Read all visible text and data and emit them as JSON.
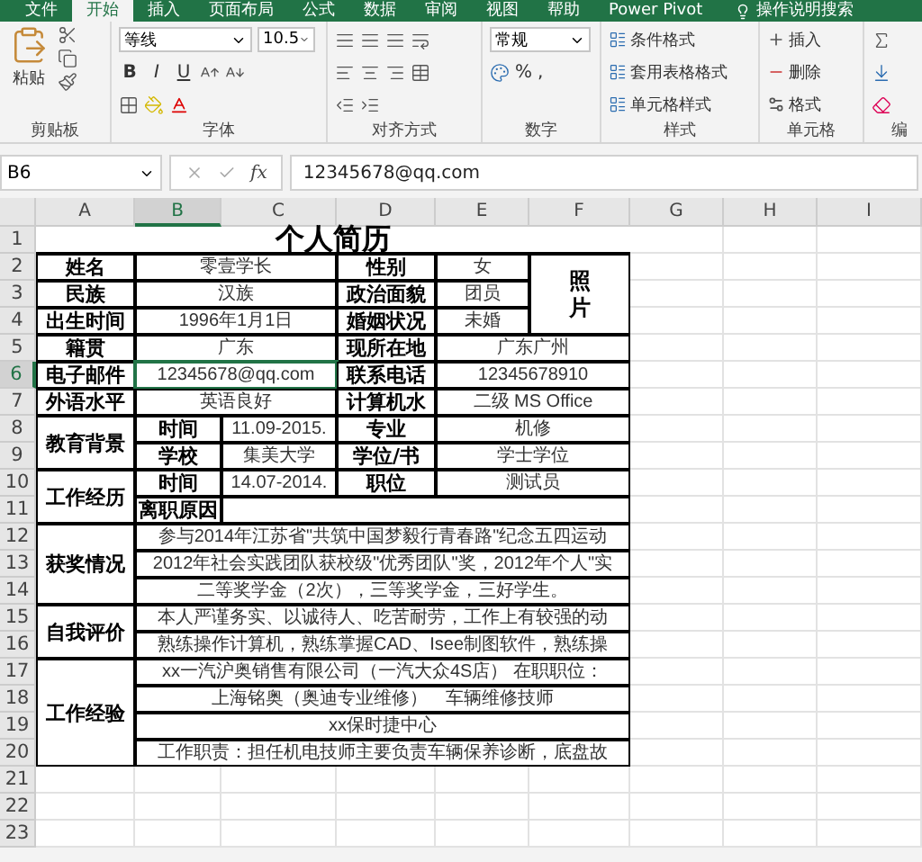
{
  "ribbon_tabs": [
    {
      "label": "文件",
      "selected": false
    },
    {
      "label": "开始",
      "selected": true
    },
    {
      "label": "插入",
      "selected": false
    },
    {
      "label": "页面布局",
      "selected": false
    },
    {
      "label": "公式",
      "selected": false
    },
    {
      "label": "数据",
      "selected": false
    },
    {
      "label": "审阅",
      "selected": false
    },
    {
      "label": "视图",
      "selected": false
    },
    {
      "label": "帮助",
      "selected": false
    },
    {
      "label": "Power Pivot",
      "selected": false
    }
  ],
  "tell_me": "操作说明搜索",
  "clipboard": {
    "paste": "粘贴",
    "title": "剪贴板"
  },
  "font": {
    "name": "等线",
    "size": "10.5",
    "bold": "B",
    "italic": "I",
    "underline": "U",
    "title": "字体"
  },
  "alignment": {
    "title": "对齐方式"
  },
  "number": {
    "format": "常规",
    "percent": "%",
    "comma": ",",
    "title": "数字"
  },
  "styles": {
    "items": [
      "条件格式",
      "套用表格格式",
      "单元格样式"
    ],
    "title": "样式"
  },
  "cells_group": {
    "items": [
      "插入",
      "删除",
      "格式"
    ],
    "title": "单元格"
  },
  "editing": {
    "title": "编"
  },
  "formula_bar": {
    "name_box": "B6",
    "fx": "fx",
    "value": "12345678@qq.com"
  },
  "sheet": {
    "columns": [
      {
        "label": "A",
        "selected": false
      },
      {
        "label": "B",
        "selected": true
      },
      {
        "label": "C",
        "selected": false
      },
      {
        "label": "D",
        "selected": false
      },
      {
        "label": "E",
        "selected": false
      },
      {
        "label": "F",
        "selected": false
      },
      {
        "label": "G",
        "selected": false
      },
      {
        "label": "H",
        "selected": false
      },
      {
        "label": "I",
        "selected": false
      }
    ],
    "rows": [
      {
        "label": "1",
        "selected": false
      },
      {
        "label": "2",
        "selected": false
      },
      {
        "label": "3",
        "selected": false
      },
      {
        "label": "4",
        "selected": false
      },
      {
        "label": "5",
        "selected": false
      },
      {
        "label": "6",
        "selected": true
      },
      {
        "label": "7",
        "selected": false
      },
      {
        "label": "8",
        "selected": false
      },
      {
        "label": "9",
        "selected": false
      },
      {
        "label": "10",
        "selected": false
      },
      {
        "label": "11",
        "selected": false
      },
      {
        "label": "12",
        "selected": false
      },
      {
        "label": "13",
        "selected": false
      },
      {
        "label": "14",
        "selected": false
      },
      {
        "label": "15",
        "selected": false
      },
      {
        "label": "16",
        "selected": false
      },
      {
        "label": "17",
        "selected": false
      },
      {
        "label": "18",
        "selected": false
      },
      {
        "label": "19",
        "selected": false
      },
      {
        "label": "20",
        "selected": false
      },
      {
        "label": "21",
        "selected": false
      },
      {
        "label": "22",
        "selected": false
      },
      {
        "label": "23",
        "selected": false
      }
    ],
    "cells": [
      {
        "kind": "title",
        "text": "个人简历",
        "selected": false
      },
      {
        "kind": "label",
        "text": "姓名",
        "selected": false
      },
      {
        "kind": "value",
        "text": "零壹学长",
        "selected": false
      },
      {
        "kind": "label",
        "text": "性别",
        "selected": false
      },
      {
        "kind": "value",
        "text": "女",
        "selected": false
      },
      {
        "kind": "label",
        "text": "民族",
        "selected": false
      },
      {
        "kind": "value",
        "text": "汉族",
        "selected": false
      },
      {
        "kind": "label",
        "text": "政治面貌",
        "selected": false
      },
      {
        "kind": "value",
        "text": "团员",
        "selected": false
      },
      {
        "kind": "label",
        "text": "出生时间",
        "selected": false
      },
      {
        "kind": "value",
        "text": "1996年1月1日",
        "selected": false
      },
      {
        "kind": "label",
        "text": "婚姻状况",
        "selected": false
      },
      {
        "kind": "value",
        "text": "未婚",
        "selected": false
      },
      {
        "kind": "photo",
        "text": "照片",
        "selected": false
      },
      {
        "kind": "label",
        "text": "籍贯",
        "selected": false
      },
      {
        "kind": "value",
        "text": "广东",
        "selected": false
      },
      {
        "kind": "label",
        "text": "现所在地",
        "selected": false
      },
      {
        "kind": "value",
        "text": "广东广州",
        "selected": false
      },
      {
        "kind": "label",
        "text": "电子邮件",
        "selected": false
      },
      {
        "kind": "value",
        "text": "12345678@qq.com",
        "selected": true
      },
      {
        "kind": "label",
        "text": "联系电话",
        "selected": false
      },
      {
        "kind": "value",
        "text": "12345678910",
        "selected": false
      },
      {
        "kind": "label",
        "text": "外语水平",
        "selected": false
      },
      {
        "kind": "value",
        "text": "英语良好",
        "selected": false
      },
      {
        "kind": "label",
        "text": "计算机水",
        "selected": false
      },
      {
        "kind": "value",
        "text": "二级 MS Office",
        "selected": false
      },
      {
        "kind": "label",
        "text": "教育背景",
        "selected": false
      },
      {
        "kind": "label",
        "text": "时间",
        "selected": false
      },
      {
        "kind": "value",
        "text": "11.09-2015.",
        "selected": false
      },
      {
        "kind": "label",
        "text": "专业",
        "selected": false
      },
      {
        "kind": "value",
        "text": "机修",
        "selected": false
      },
      {
        "kind": "label",
        "text": "学校",
        "selected": false
      },
      {
        "kind": "value",
        "text": "集美大学",
        "selected": false
      },
      {
        "kind": "label",
        "text": "学位/书",
        "selected": false
      },
      {
        "kind": "value",
        "text": "学士学位",
        "selected": false
      },
      {
        "kind": "label",
        "text": "工作经历",
        "selected": false
      },
      {
        "kind": "label",
        "text": "时间",
        "selected": false
      },
      {
        "kind": "value",
        "text": "14.07-2014.",
        "selected": false
      },
      {
        "kind": "label",
        "text": "职位",
        "selected": false
      },
      {
        "kind": "value",
        "text": "测试员",
        "selected": false
      },
      {
        "kind": "label",
        "text": "离职原因",
        "selected": false
      },
      {
        "kind": "value",
        "selected": false
      },
      {
        "kind": "label",
        "text": "获奖情况",
        "selected": false
      },
      {
        "kind": "value",
        "text": "参与2014年江苏省\"共筑中国梦毅行青春路\"纪念五四运动",
        "selected": false
      },
      {
        "kind": "value",
        "text": "2012年社会实践团队获校级\"优秀团队\"奖，2012年个人\"实",
        "selected": false
      },
      {
        "kind": "value",
        "text": "二等奖学金（2次），三等奖学金，三好学生。",
        "selected": false
      },
      {
        "kind": "label",
        "text": "自我评价",
        "selected": false
      },
      {
        "kind": "value",
        "text": "本人严谨务实、以诚待人、吃苦耐劳，工作上有较强的动",
        "selected": false
      },
      {
        "kind": "value",
        "text": "熟练操作计算机，熟练掌握CAD、Isee制图软件，熟练操",
        "selected": false
      },
      {
        "kind": "label",
        "text": "工作经验",
        "selected": false
      },
      {
        "kind": "value",
        "text": "xx一汽沪奥销售有限公司（一汽大众4S店） 在职职位：",
        "selected": false
      },
      {
        "kind": "value",
        "text": "上海铭奥（奥迪专业维修）　车辆维修技师",
        "selected": false
      },
      {
        "kind": "value",
        "text": "xx保时捷中心",
        "selected": false
      },
      {
        "kind": "value",
        "text": "工作职责：担任机电技师主要负责车辆保养诊断，底盘故",
        "selected": false
      }
    ]
  }
}
